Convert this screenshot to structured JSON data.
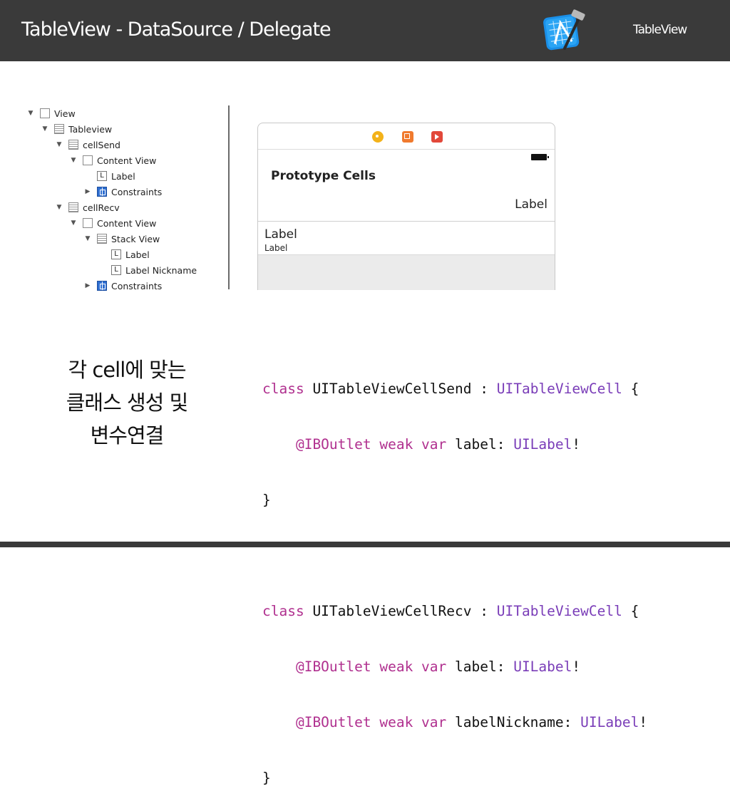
{
  "header": {
    "title": "TableView - DataSource / Delegate",
    "right_label": "TableView",
    "background": "#3a3a3a"
  },
  "outline": [
    {
      "label": "View",
      "icon": "view-icon",
      "arrow": "▼"
    },
    {
      "label": "Tableview",
      "icon": "tableview-icon",
      "arrow": "▼"
    },
    {
      "label": "cellSend",
      "icon": "tableview-cell-icon",
      "arrow": "▼"
    },
    {
      "label": "Content View",
      "icon": "view-icon",
      "arrow": "▼"
    },
    {
      "label": "Label",
      "icon": "label-icon",
      "arrow": ""
    },
    {
      "label": "Constraints",
      "icon": "constraints-icon",
      "arrow": "▶"
    },
    {
      "label": "cellRecv",
      "icon": "tableview-cell-icon",
      "arrow": "▼"
    },
    {
      "label": "Content View",
      "icon": "view-icon",
      "arrow": "▼"
    },
    {
      "label": "Stack View",
      "icon": "stack-view-icon",
      "arrow": "▼"
    },
    {
      "label": "Label",
      "icon": "label-icon",
      "arrow": ""
    },
    {
      "label": "Label Nickname",
      "icon": "label-icon",
      "arrow": ""
    },
    {
      "label": "Constraints",
      "icon": "constraints-icon",
      "arrow": "▶"
    }
  ],
  "storyboard": {
    "section_title": "Prototype Cells",
    "cell1_label": "Label",
    "cell2_title": "Label",
    "cell2_subtitle": "Label"
  },
  "caption": {
    "line1": "각 cell에 맞는",
    "line2": "클래스 생성 및",
    "line3": "변수연결"
  },
  "code": {
    "class1_kw": "class",
    "class1_name": " UITableViewCellSend : ",
    "class1_super": "UITableViewCell",
    "open_brace": " {",
    "class1_prop1_kw": "    @IBOutlet weak var",
    "class1_prop1_name": " label: ",
    "class1_prop1_type": "UILabel",
    "bang": "!",
    "close_brace": "}",
    "class2_kw": "class",
    "class2_name": " UITableViewCellRecv : ",
    "class2_super": "UITableViewCell",
    "class2_prop1_kw": "    @IBOutlet weak var",
    "class2_prop1_name": " label: ",
    "class2_prop1_type": "UILabel",
    "class2_prop2_kw": "    @IBOutlet weak var",
    "class2_prop2_name": " labelNickname: ",
    "class2_prop2_type": "UILabel",
    "keyword_color": "#b0308f",
    "type_color": "#7a3db8"
  }
}
